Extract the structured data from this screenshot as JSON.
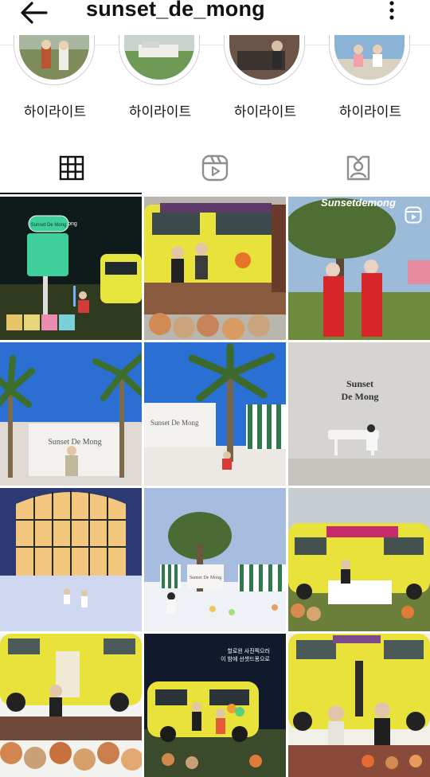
{
  "header": {
    "username": "sunset_de_mong",
    "back_icon": "arrow-left-icon",
    "menu_icon": "more-vertical-icon"
  },
  "highlights": [
    {
      "label": "하이라이트"
    },
    {
      "label": "하이라이트"
    },
    {
      "label": "하이라이트"
    },
    {
      "label": "하이라이트"
    }
  ],
  "tabs": [
    {
      "name": "grid",
      "icon": "grid-icon",
      "active": true
    },
    {
      "name": "reels",
      "icon": "reels-icon",
      "active": false
    },
    {
      "name": "tagged",
      "icon": "tagged-user-icon",
      "active": false
    }
  ],
  "posts": {
    "p1": {
      "tag": "@sunset_de_mong",
      "sign_title": "Sunset De Mong"
    },
    "p3": {
      "overlay": "Sunsetdemong",
      "badge": "reel-icon"
    },
    "p4": {
      "wall_text": "Sunset De Mong"
    },
    "p5": {
      "wall_text": "Sunset De Mong"
    },
    "p6": {
      "wall_line1": "Sunset",
      "wall_line2": "De Mong"
    },
    "p8": {
      "wall_text": "Sunset De Mong"
    },
    "p11": {
      "caption_line1": "할로윈 사진찍으러",
      "caption_line2": "이 밤에 선셋드몽으로"
    }
  },
  "colors": {
    "accent": "#111111",
    "divider": "#e6e6e6",
    "van_yellow": "#e8e23a"
  }
}
